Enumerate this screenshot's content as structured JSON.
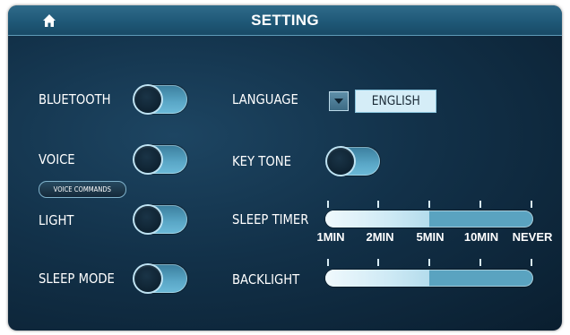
{
  "header": {
    "title": "SETTING",
    "home_icon": "home-icon"
  },
  "bluetooth": {
    "label": "BLUETOOTH",
    "state": "off"
  },
  "voice": {
    "label": "VOICE",
    "state": "off",
    "commands_button": "VOICE COMMANDS"
  },
  "light": {
    "label": "LIGHT",
    "state": "off"
  },
  "sleep_mode": {
    "label": "SLEEP MODE",
    "state": "off"
  },
  "language": {
    "label": "LANGUAGE",
    "value": "ENGLISH"
  },
  "key_tone": {
    "label": "KEY TONE",
    "state": "off"
  },
  "sleep_timer": {
    "label": "SLEEP TIMER",
    "options": [
      "1MIN",
      "2MIN",
      "5MIN",
      "10MIN",
      "NEVER"
    ],
    "selected": "5MIN",
    "level": 0.5
  },
  "backlight": {
    "label": "BACKLIGHT",
    "level": 0.5
  },
  "colors": {
    "panel": "#123149",
    "header": "#1f5877",
    "toggle_track": "#5aa7c7",
    "slider_fill": "#e6f4fa",
    "slider_track": "#5aa3c0"
  }
}
